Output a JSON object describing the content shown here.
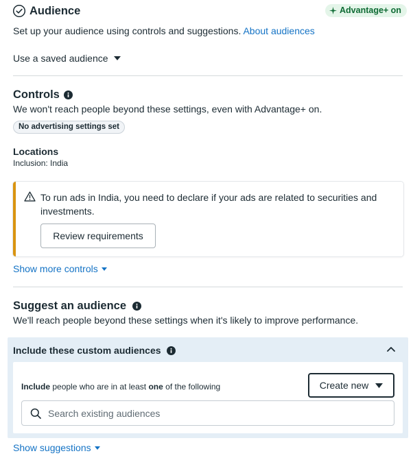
{
  "header": {
    "title": "Audience",
    "badge": "Advantage+ on",
    "subtitle": "Set up your audience using controls and suggestions.",
    "about_link": "About audiences",
    "saved_audience": "Use a saved audience"
  },
  "controls": {
    "title": "Controls",
    "description": "We won't reach people beyond these settings, even with Advantage+ on.",
    "pill": "No advertising settings set",
    "locations_title": "Locations",
    "inclusion_label": "Inclusion:",
    "inclusion_value": "India",
    "warning_text": "To run ads in India, you need to declare if your ads are related to securities and investments.",
    "review_button": "Review requirements",
    "show_more": "Show more controls"
  },
  "suggest": {
    "title": "Suggest an audience",
    "description": "We'll reach people beyond these settings when it's likely to improve performance.",
    "custom_title": "Include these custom audiences",
    "include_bold": "Include",
    "include_mid": "people who are in at least",
    "include_one": "one",
    "include_end": "of the following",
    "create_button": "Create new",
    "search_placeholder": "Search existing audiences",
    "show_suggestions": "Show suggestions"
  },
  "colors": {
    "link": "#1473c5",
    "badge_bg": "#e4f5e9",
    "badge_text": "#0e6b34",
    "warning_accent": "#d99411",
    "panel_bg": "#e4eef6"
  }
}
